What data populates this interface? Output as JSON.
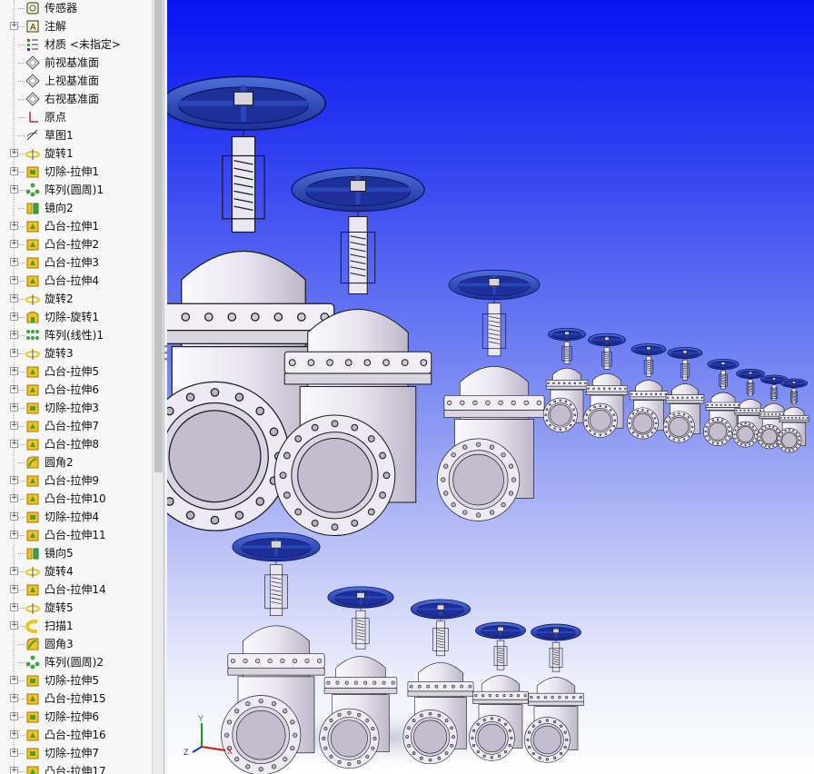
{
  "feature_tree": {
    "items": [
      {
        "label": "传感器",
        "icon": "sensor-icon",
        "expandable": false
      },
      {
        "label": "注解",
        "icon": "annotation-icon",
        "expandable": true
      },
      {
        "label": "材质 <未指定>",
        "icon": "material-icon",
        "expandable": false
      },
      {
        "label": "前视基准面",
        "icon": "plane-icon",
        "expandable": false
      },
      {
        "label": "上视基准面",
        "icon": "plane-icon",
        "expandable": false
      },
      {
        "label": "右视基准面",
        "icon": "plane-icon",
        "expandable": false
      },
      {
        "label": "原点",
        "icon": "origin-icon",
        "expandable": false
      },
      {
        "label": "草图1",
        "icon": "sketch-icon",
        "expandable": false
      },
      {
        "label": "旋转1",
        "icon": "revolve-icon",
        "expandable": true
      },
      {
        "label": "切除-拉伸1",
        "icon": "cut-extrude-icon",
        "expandable": true
      },
      {
        "label": "阵列(圆周)1",
        "icon": "circular-pattern-icon",
        "expandable": true
      },
      {
        "label": "镜向2",
        "icon": "mirror-icon",
        "expandable": false
      },
      {
        "label": "凸台-拉伸1",
        "icon": "boss-extrude-icon",
        "expandable": true
      },
      {
        "label": "凸台-拉伸2",
        "icon": "boss-extrude-icon",
        "expandable": true
      },
      {
        "label": "凸台-拉伸3",
        "icon": "boss-extrude-icon",
        "expandable": true
      },
      {
        "label": "凸台-拉伸4",
        "icon": "boss-extrude-icon",
        "expandable": true
      },
      {
        "label": "旋转2",
        "icon": "revolve-icon",
        "expandable": true
      },
      {
        "label": "切除-旋转1",
        "icon": "cut-revolve-icon",
        "expandable": true
      },
      {
        "label": "阵列(线性)1",
        "icon": "linear-pattern-icon",
        "expandable": true
      },
      {
        "label": "旋转3",
        "icon": "revolve-icon",
        "expandable": true
      },
      {
        "label": "凸台-拉伸5",
        "icon": "boss-extrude-icon",
        "expandable": true
      },
      {
        "label": "凸台-拉伸6",
        "icon": "boss-extrude-icon",
        "expandable": true
      },
      {
        "label": "切除-拉伸3",
        "icon": "cut-extrude-icon",
        "expandable": true
      },
      {
        "label": "凸台-拉伸7",
        "icon": "boss-extrude-icon",
        "expandable": true
      },
      {
        "label": "凸台-拉伸8",
        "icon": "boss-extrude-icon",
        "expandable": true
      },
      {
        "label": "圆角2",
        "icon": "fillet-icon",
        "expandable": false
      },
      {
        "label": "凸台-拉伸9",
        "icon": "boss-extrude-icon",
        "expandable": true
      },
      {
        "label": "凸台-拉伸10",
        "icon": "boss-extrude-icon",
        "expandable": true
      },
      {
        "label": "切除-拉伸4",
        "icon": "cut-extrude-icon",
        "expandable": true
      },
      {
        "label": "凸台-拉伸11",
        "icon": "boss-extrude-icon",
        "expandable": true
      },
      {
        "label": "镜向5",
        "icon": "mirror-icon",
        "expandable": false
      },
      {
        "label": "旋转4",
        "icon": "revolve-icon",
        "expandable": true
      },
      {
        "label": "凸台-拉伸14",
        "icon": "boss-extrude-icon",
        "expandable": true
      },
      {
        "label": "旋转5",
        "icon": "revolve-icon",
        "expandable": true
      },
      {
        "label": "扫描1",
        "icon": "sweep-icon",
        "expandable": true
      },
      {
        "label": "圆角3",
        "icon": "fillet-icon",
        "expandable": false
      },
      {
        "label": "阵列(圆周)2",
        "icon": "circular-pattern-icon",
        "expandable": false
      },
      {
        "label": "切除-拉伸5",
        "icon": "cut-extrude-icon",
        "expandable": true
      },
      {
        "label": "凸台-拉伸15",
        "icon": "boss-extrude-icon",
        "expandable": true
      },
      {
        "label": "切除-拉伸6",
        "icon": "cut-extrude-icon",
        "expandable": true
      },
      {
        "label": "凸台-拉伸16",
        "icon": "boss-extrude-icon",
        "expandable": true
      },
      {
        "label": "切除-拉伸7",
        "icon": "cut-extrude-icon",
        "expandable": true
      },
      {
        "label": "凸台-拉伸17",
        "icon": "boss-extrude-icon",
        "expandable": true
      }
    ]
  },
  "viewport": {
    "background_top": "#0a12f2",
    "background_bottom": "#ffffff",
    "handwheel_color": "#2a45b8",
    "body_color": "#e6e2ec",
    "triad_labels": {
      "x": "X",
      "y": "Y",
      "z": "Z"
    }
  },
  "colors": {
    "tree_background": "#f7f7f7",
    "boss_icon_yellow": "#f2c320",
    "boss_icon_green": "#3da33a"
  }
}
